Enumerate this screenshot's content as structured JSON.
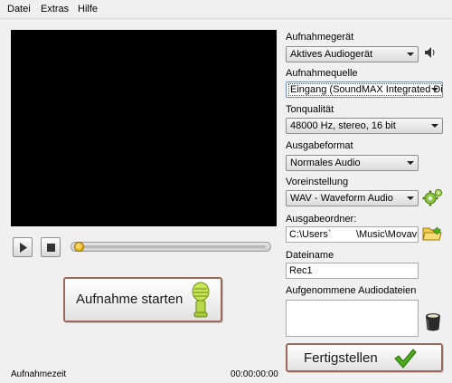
{
  "menu": {
    "datei": "Datei",
    "extras": "Extras",
    "hilfe": "Hilfe"
  },
  "playback": {
    "play_icon": "play-icon",
    "stop_icon": "stop-icon",
    "position_fraction": 0.02
  },
  "start_button": {
    "label": "Aufnahme starten",
    "icon": "microphone-icon"
  },
  "device": {
    "label": "Aufnahmegerät",
    "value": "Aktives Audiogerät",
    "icon": "speaker-icon"
  },
  "source": {
    "label": "Aufnahmequelle",
    "value": "Eingang (SoundMAX Integrated Digital Audio)"
  },
  "quality": {
    "label": "Tonqualität",
    "value": "48000 Hz, stereo, 16 bit"
  },
  "format": {
    "label": "Ausgabeformat",
    "value": "Normales Audio"
  },
  "preset": {
    "label": "Voreinstellung",
    "value": "WAV - Waveform Audio",
    "icon": "gear-icon"
  },
  "output_folder": {
    "label": "Ausgabeordner:",
    "value": "C:\\Users`         \\Music\\Movavi Library",
    "icon": "folder-icon"
  },
  "filename": {
    "label": "Dateiname",
    "value": "Rec1"
  },
  "recorded_files": {
    "label": "Aufgenommene Audiodateien",
    "items": [],
    "icon": "trash-bin-icon"
  },
  "finish_button": {
    "label": "Fertigstellen",
    "icon": "checkmark-icon"
  },
  "status": {
    "time_label": "Aufnahmezeit",
    "time_value": "00:00:00:00"
  },
  "colors": {
    "accent_green": "#4caf1a",
    "button_border": "#9a6a58",
    "video_bg": "#000000"
  }
}
